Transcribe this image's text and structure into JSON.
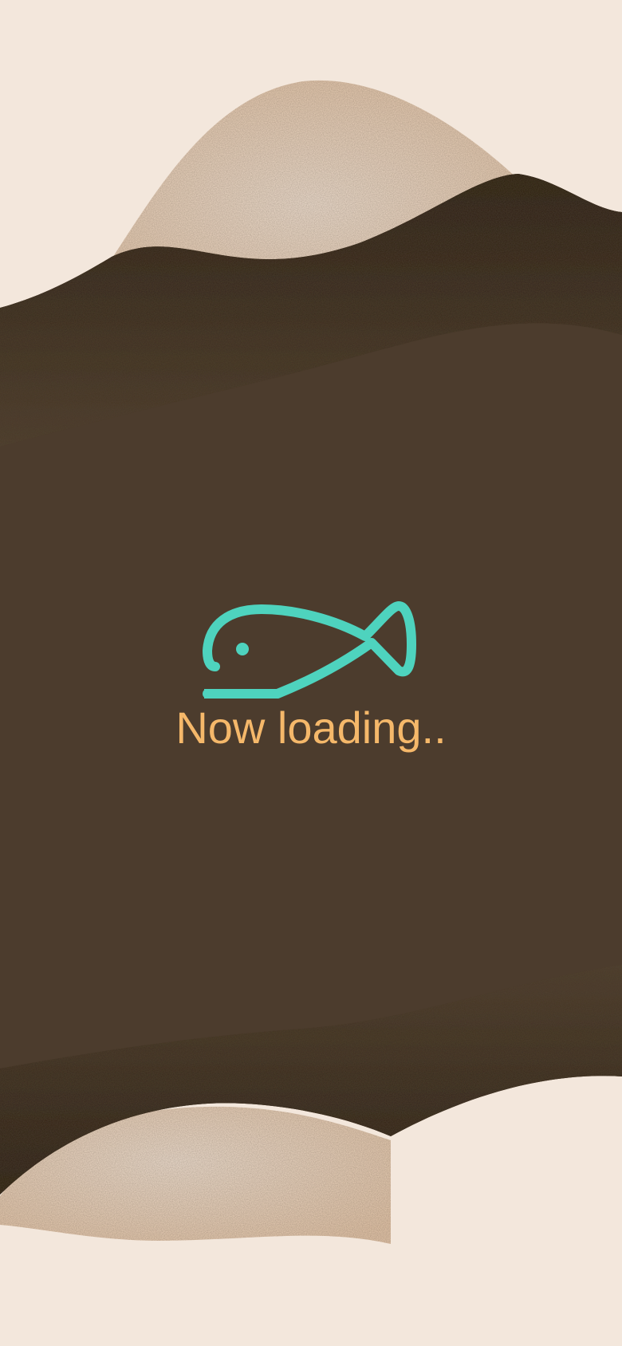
{
  "screen": {
    "name": "loading-screen"
  },
  "loader": {
    "icon": "fish-icon",
    "text": "Now loading.."
  },
  "colors": {
    "background_cream": "#F3E7DC",
    "wave_tan": "#E8CBB0",
    "wave_dark": "#2E2117",
    "main_brown": "#4C3C2D",
    "accent_teal": "#4ED3BE",
    "text_orange": "#F5B86A"
  }
}
